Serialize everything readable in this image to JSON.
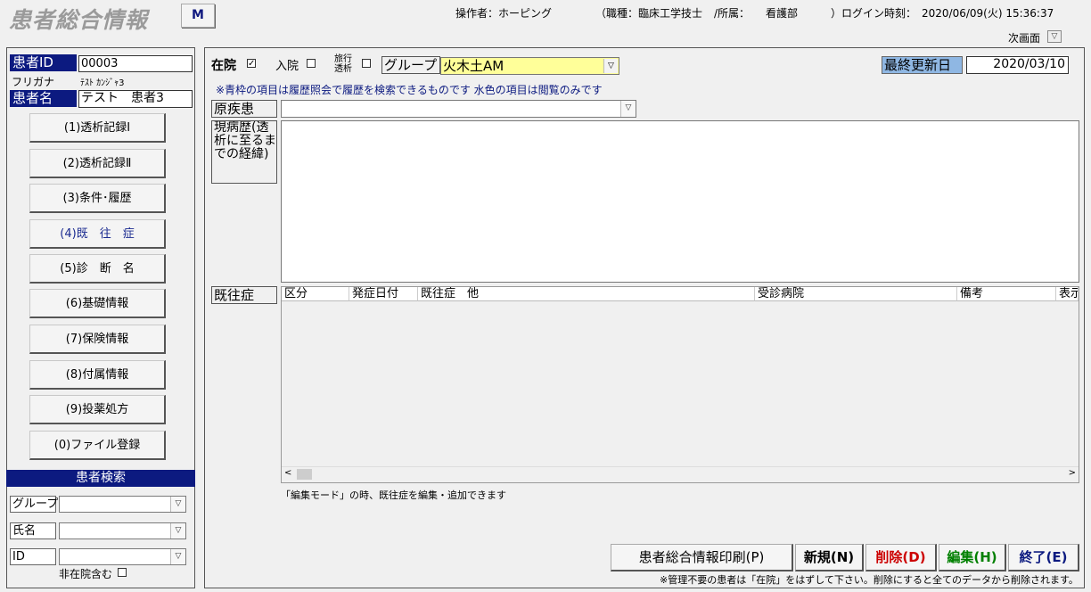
{
  "header": {
    "title": "患者総合情報",
    "m_button": "M",
    "operator": "操作者：ホーピング",
    "role": "（職種：臨床工学技士",
    "department_label": "/所属：",
    "department": "看護部",
    "login_label": "）ログイン時刻：",
    "login_time": "2020/06/09(火) 15:36:37",
    "next_screen": "次画面"
  },
  "patient": {
    "id_label": "患者ID",
    "id": "00003",
    "furigana_label": "フリガナ",
    "furigana": "ﾃｽﾄ ｶﾝｼﾞｬ3",
    "name_label": "患者名",
    "name": "テスト　患者3"
  },
  "nav": [
    {
      "label": "(1)透析記録Ⅰ"
    },
    {
      "label": "(2)透析記録Ⅱ"
    },
    {
      "label": "(3)条件･履歴"
    },
    {
      "label": "(4)既　往　症"
    },
    {
      "label": "(5)診　断　名"
    },
    {
      "label": "(6)基礎情報"
    },
    {
      "label": "(7)保険情報"
    },
    {
      "label": "(8)付属情報"
    },
    {
      "label": "(9)投薬処方"
    },
    {
      "label": "(0)ファイル登録"
    }
  ],
  "search": {
    "header": "患者検索",
    "group_label": "グループ",
    "name_label": "氏名",
    "id_label": "ID",
    "include_discharged": "非在院含む"
  },
  "main": {
    "in_hospital": "在院",
    "hospitalized": "入院",
    "travel_dialysis": "旅行透析",
    "group_label": "グループ",
    "group_value": "火木土AM",
    "last_update_label": "最終更新日",
    "last_update": "2020/03/10",
    "note": "※青枠の項目は履歴照会で履歴を検索できるものです  水色の項目は閲覧のみです",
    "primary_disease_label": "原疾患",
    "present_illness_label": "現病歴(透析に至るまでの経緯)",
    "past_history_label": "既往症",
    "grid_columns": [
      "区分",
      "発症日付",
      "既往症　他",
      "受診病院",
      "備考",
      "表示"
    ],
    "edit_note": "「編集モード」の時、既往症を編集・追加できます"
  },
  "buttons": {
    "print": "患者総合情報印刷(P)",
    "new": "新規(N)",
    "delete": "削除(D)",
    "edit": "編集(H)",
    "exit": "終了(E)"
  },
  "footer_note": "※管理不要の患者は「在院」をはずして下さい。削除にすると全てのデータから削除されます。",
  "colors": {
    "navy": "#0c1a80",
    "group_yellow": "#ffff99",
    "last_update_blue": "#8fb7e3",
    "delete_red": "#cc0000",
    "edit_green": "#008000",
    "exit_blue": "#0c1a80"
  }
}
